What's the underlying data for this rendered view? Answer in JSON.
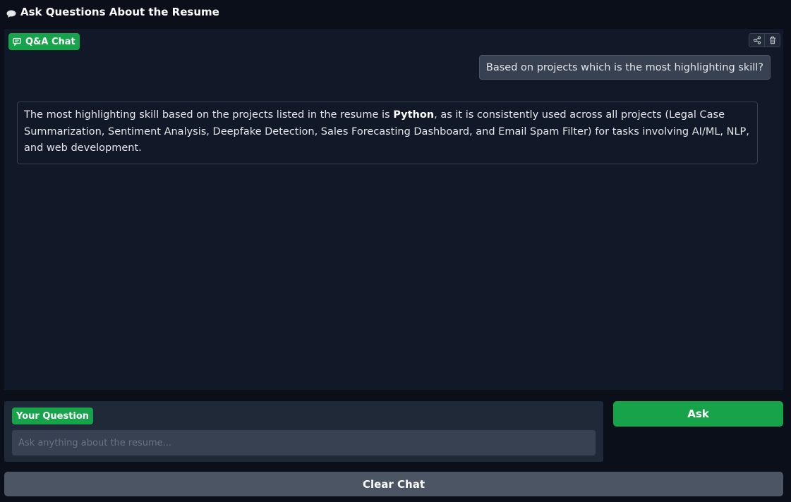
{
  "heading": {
    "icon": "speech-bubble-icon",
    "title": "Ask Questions About the Resume"
  },
  "chat": {
    "label": "Q&A Chat",
    "label_icon": "chat-icon",
    "tools": [
      "share-icon",
      "trash-icon"
    ],
    "messages": [
      {
        "role": "user",
        "text": "Based on projects which is the most highlighting skill?"
      },
      {
        "role": "assistant",
        "text_before": "The most highlighting skill based on the projects listed in the resume is ",
        "bold": "Python",
        "text_after": ", as it is consistently used across all projects (Legal Case Summarization, Sentiment Analysis, Deepfake Detection, Sales Forecasting Dashboard, and Email Spam Filter) for tasks involving AI/ML, NLP, and web development."
      }
    ]
  },
  "question": {
    "label": "Your Question",
    "placeholder": "Ask anything about the resume...",
    "value": ""
  },
  "buttons": {
    "ask": "Ask",
    "clear": "Clear Chat"
  },
  "colors": {
    "accent": "#16a34a",
    "background": "#0b0f19",
    "panel": "#111827",
    "secondary_button": "#4b5563"
  }
}
